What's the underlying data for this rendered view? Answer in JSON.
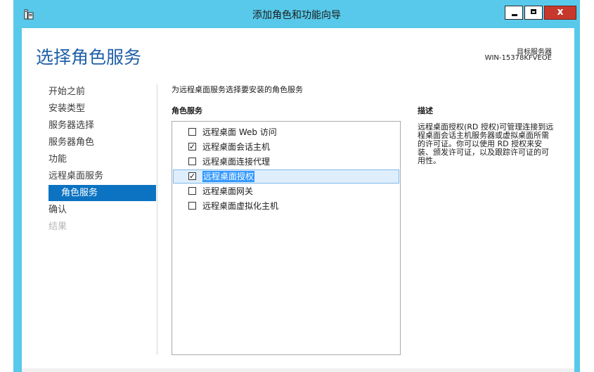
{
  "window": {
    "title": "添加角色和功能向导",
    "minimize_glyph": "",
    "close_glyph": "x"
  },
  "header": {
    "page_title": "选择角色服务",
    "target_label": "目标服务器",
    "target_value": "WIN-15378KFVEOE"
  },
  "nav": {
    "items": [
      {
        "label": "开始之前",
        "state": "normal"
      },
      {
        "label": "安装类型",
        "state": "normal"
      },
      {
        "label": "服务器选择",
        "state": "normal"
      },
      {
        "label": "服务器角色",
        "state": "normal"
      },
      {
        "label": "功能",
        "state": "normal"
      },
      {
        "label": "远程桌面服务",
        "state": "normal"
      },
      {
        "label": "角色服务",
        "state": "active"
      },
      {
        "label": "确认",
        "state": "normal"
      },
      {
        "label": "结果",
        "state": "disabled"
      }
    ]
  },
  "main": {
    "instruction": "为远程桌面服务选择要安装的角色服务",
    "list_header": "角色服务",
    "roles": [
      {
        "label": "远程桌面 Web 访问",
        "checked": false,
        "selected": false
      },
      {
        "label": "远程桌面会话主机",
        "checked": true,
        "selected": false
      },
      {
        "label": "远程桌面连接代理",
        "checked": false,
        "selected": false
      },
      {
        "label": "远程桌面授权",
        "checked": true,
        "selected": true
      },
      {
        "label": "远程桌面网关",
        "checked": false,
        "selected": false
      },
      {
        "label": "远程桌面虚拟化主机",
        "checked": false,
        "selected": false
      }
    ]
  },
  "description": {
    "header": "描述",
    "text": "远程桌面授权(RD 授权)可管理连接到远程桌面会话主机服务器或虚拟桌面所需的许可证。你可以使用 RD 授权来安装、颁发许可证，以及跟踪许可证的可用性。"
  },
  "colors": {
    "chrome": "#58c9ea",
    "title_blue": "#1f5fa8",
    "nav_active": "#0c73c2",
    "close_red": "#c7382c"
  },
  "icons": {
    "app": "server-manager-icon",
    "minimize": "minimize-icon",
    "maximize": "maximize-icon",
    "close": "close-icon",
    "check": "checkmark-icon"
  }
}
